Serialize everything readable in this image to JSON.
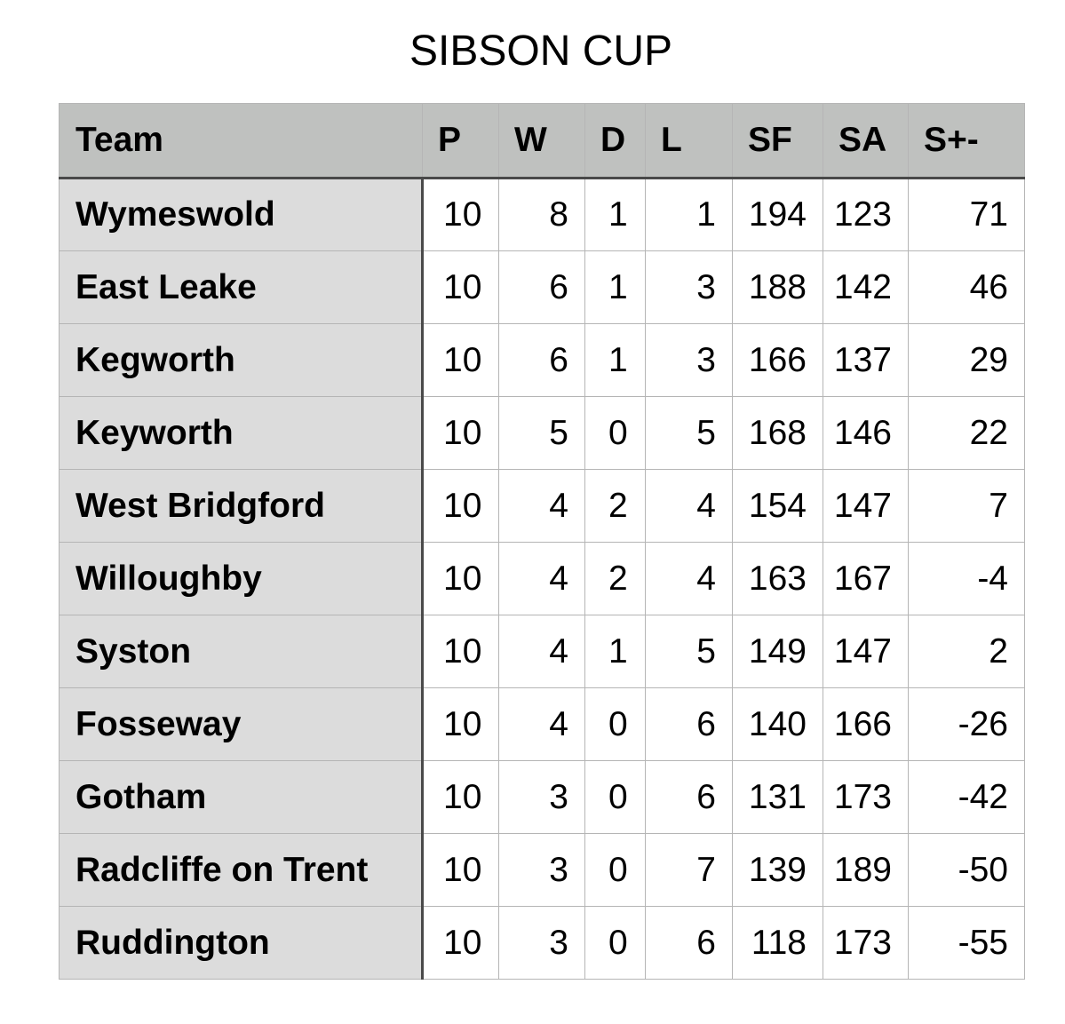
{
  "title": "SIBSON CUP",
  "table": {
    "headers": [
      "Team",
      "P",
      "W",
      "D",
      "L",
      "SF",
      "SA",
      "S+-"
    ],
    "rows": [
      {
        "team": "Wymeswold",
        "p": "10",
        "w": "8",
        "d": "1",
        "l": "1",
        "sf": "194",
        "sa": "123",
        "diff": "71"
      },
      {
        "team": "East Leake",
        "p": "10",
        "w": "6",
        "d": "1",
        "l": "3",
        "sf": "188",
        "sa": "142",
        "diff": "46"
      },
      {
        "team": "Kegworth",
        "p": "10",
        "w": "6",
        "d": "1",
        "l": "3",
        "sf": "166",
        "sa": "137",
        "diff": "29"
      },
      {
        "team": "Keyworth",
        "p": "10",
        "w": "5",
        "d": "0",
        "l": "5",
        "sf": "168",
        "sa": "146",
        "diff": "22"
      },
      {
        "team": "West Bridgford",
        "p": "10",
        "w": "4",
        "d": "2",
        "l": "4",
        "sf": "154",
        "sa": "147",
        "diff": "7"
      },
      {
        "team": "Willoughby",
        "p": "10",
        "w": "4",
        "d": "2",
        "l": "4",
        "sf": "163",
        "sa": "167",
        "diff": "-4"
      },
      {
        "team": "Syston",
        "p": "10",
        "w": "4",
        "d": "1",
        "l": "5",
        "sf": "149",
        "sa": "147",
        "diff": "2"
      },
      {
        "team": "Fosseway",
        "p": "10",
        "w": "4",
        "d": "0",
        "l": "6",
        "sf": "140",
        "sa": "166",
        "diff": "-26"
      },
      {
        "team": "Gotham",
        "p": "10",
        "w": "3",
        "d": "0",
        "l": "6",
        "sf": "131",
        "sa": "173",
        "diff": "-42"
      },
      {
        "team": "Radcliffe on Trent",
        "p": "10",
        "w": "3",
        "d": "0",
        "l": "7",
        "sf": "139",
        "sa": "189",
        "diff": "-50"
      },
      {
        "team": "Ruddington",
        "p": "10",
        "w": "3",
        "d": "0",
        "l": "6",
        "sf": "118",
        "sa": "173",
        "diff": "-55"
      }
    ]
  },
  "colors": {
    "header_bg": "#bfc1bf",
    "team_col_bg": "#dcdcdc",
    "grid_line": "#b5b5b5",
    "divider_line": "#4a4a4a"
  }
}
